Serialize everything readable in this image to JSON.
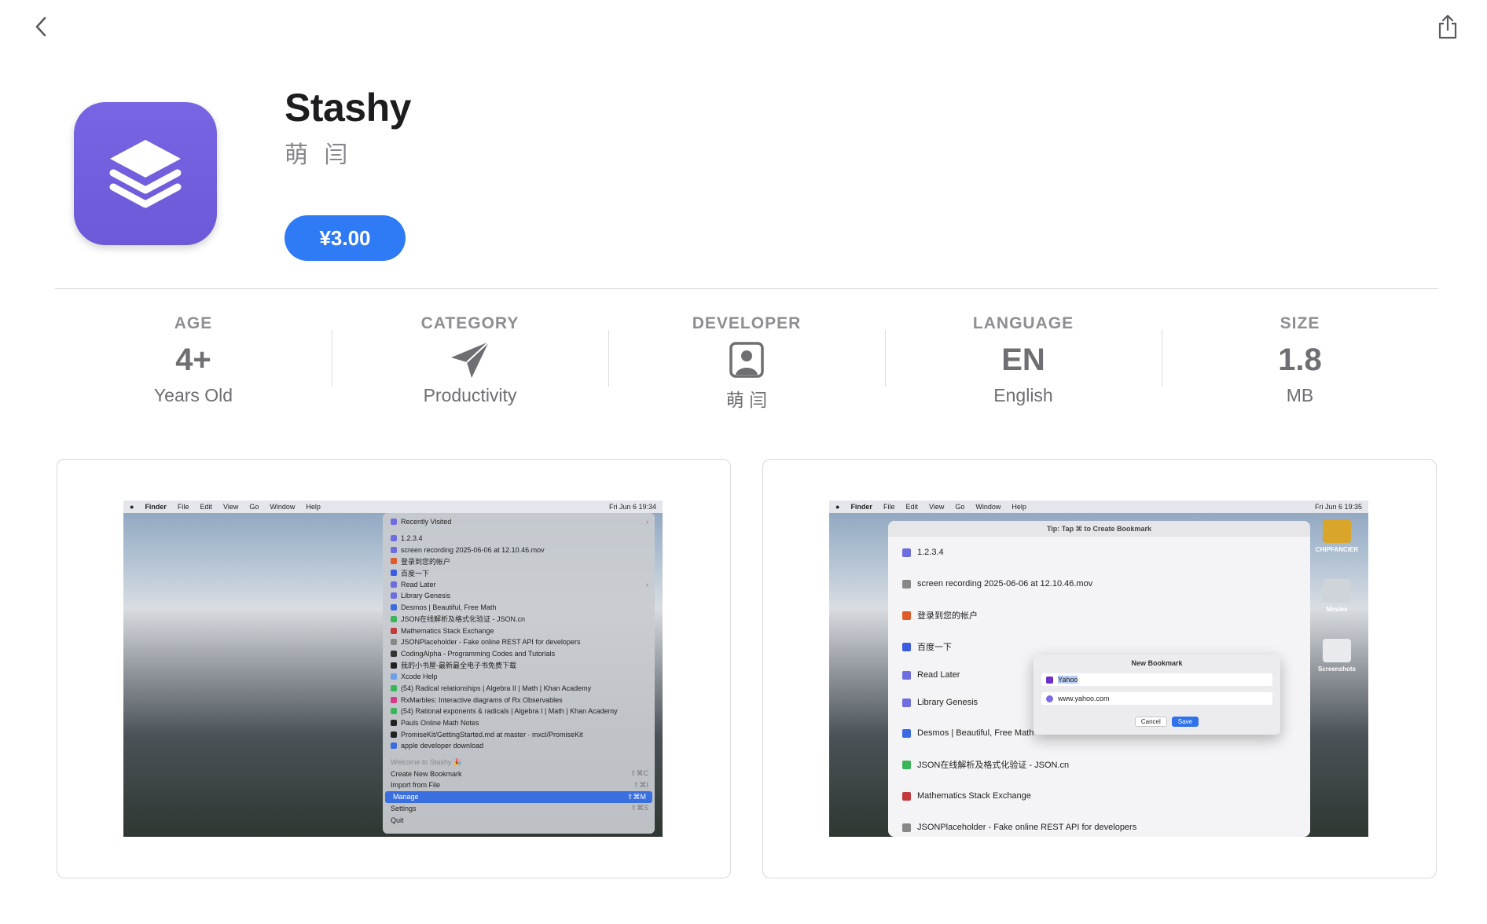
{
  "app": {
    "title": "Stashy",
    "developer": "萌 闫",
    "price": "¥3.00"
  },
  "colors": {
    "icon_bg": "#7263e0",
    "price_button": "#2f7bf5"
  },
  "info": [
    {
      "label": "AGE",
      "value": "4+",
      "sub": "Years Old"
    },
    {
      "label": "CATEGORY",
      "icon": "paper-plane-icon",
      "sub": "Productivity"
    },
    {
      "label": "DEVELOPER",
      "icon": "person-portrait-icon",
      "sub": "萌 闫"
    },
    {
      "label": "LANGUAGE",
      "value": "EN",
      "sub": "English"
    },
    {
      "label": "SIZE",
      "value": "1.8",
      "sub": "MB"
    }
  ],
  "screenshot1": {
    "menubar": {
      "left": [
        "Finder",
        "File",
        "Edit",
        "View",
        "Go",
        "Window",
        "Help"
      ],
      "clock": "Fri Jun 6  19:34"
    },
    "menu": {
      "recent": "Recently Visited",
      "items": [
        "1.2.3.4",
        "screen recording 2025-06-06 at 12.10.46.mov",
        "登录到您的帐户",
        "百度一下",
        "Read Later",
        "Library Genesis",
        "Desmos | Beautiful, Free Math",
        "JSON在线解析及格式化验证 - JSON.cn",
        "Mathematics Stack Exchange",
        "JSONPlaceholder - Fake online REST API for developers",
        "CodingAlpha - Programming Codes and Tutorials",
        "我的小书屋-最新最全电子书免费下载",
        "Xcode Help",
        "(54) Radical relationships | Algebra II | Math | Khan Academy",
        "RxMarbles: Interactive diagrams of Rx Observables",
        "(54) Rational exponents & radicals | Algebra I | Math | Khan Academy",
        "Pauls Online Math Notes",
        "PromiseKit/GettingStarted.md at master · mxcl/PromiseKit",
        "apple developer download"
      ],
      "welcome": "Welcome to Stashy 🎉",
      "actions": [
        {
          "label": "Create New Bookmark",
          "shortcut": "⇧⌘C"
        },
        {
          "label": "Import from File",
          "shortcut": "⇧⌘I"
        },
        {
          "label": "Manage",
          "shortcut": "⇧⌘M"
        },
        {
          "label": "Settings",
          "shortcut": "⇧⌘S"
        },
        {
          "label": "Quit",
          "shortcut": ""
        }
      ]
    }
  },
  "screenshot2": {
    "menubar": {
      "left": [
        "Finder",
        "File",
        "Edit",
        "View",
        "Go",
        "Window",
        "Help"
      ],
      "clock": "Fri Jun 6  19:35"
    },
    "window_title": "Tip: Tap ⌘ to Create Bookmark",
    "rows": [
      "1.2.3.4",
      "screen recording 2025-06-06 at 12.10.46.mov",
      "登录到您的帐户",
      "百度一下",
      "Read Later",
      "Library Genesis",
      "Desmos | Beautiful, Free Math",
      "JSON在线解析及格式化验证 - JSON.cn",
      "Mathematics Stack Exchange",
      "JSONPlaceholder - Fake online REST API for developers"
    ],
    "dialog": {
      "title": "New Bookmark",
      "name_value": "Yahoo",
      "url_value": "www.yahoo.com",
      "cancel": "Cancel",
      "save": "Save"
    },
    "dock": [
      "CHIPFANCIER",
      "Movies",
      "Screenshots"
    ]
  }
}
